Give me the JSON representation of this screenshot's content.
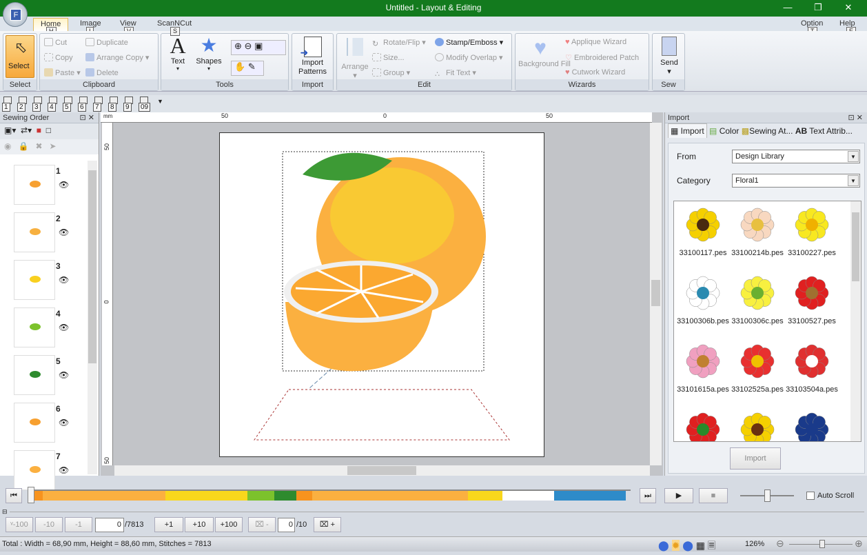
{
  "window": {
    "title": "Untitled - Layout & Editing",
    "app_letter": "F"
  },
  "menu_tabs": [
    {
      "label": "Home",
      "key": "H"
    },
    {
      "label": "Image",
      "key": "I"
    },
    {
      "label": "View",
      "key": "V"
    },
    {
      "label": "ScanNCut",
      "key": "S"
    }
  ],
  "menu_right": [
    {
      "label": "Option",
      "key": "T"
    },
    {
      "label": "Help",
      "key": "E"
    }
  ],
  "ribbon": {
    "select": {
      "label": "Select",
      "group": "Select"
    },
    "clipboard": {
      "group": "Clipboard",
      "cut": "Cut",
      "copy": "Copy",
      "paste": "Paste",
      "duplicate": "Duplicate",
      "arrange_copy": "Arrange Copy",
      "delete": "Delete"
    },
    "tools": {
      "group": "Tools",
      "text": "Text",
      "shapes": "Shapes"
    },
    "import": {
      "group": "Import",
      "import_patterns": "Import Patterns"
    },
    "edit": {
      "group": "Edit",
      "arrange": "Arrange",
      "rotate_flip": "Rotate/Flip",
      "size": "Size...",
      "group_btn": "Group",
      "stamp_emboss": "Stamp/Emboss",
      "modify_overlap": "Modify Overlap",
      "fit_text": "Fit Text"
    },
    "wizards": {
      "group": "Wizards",
      "background_fill": "Background Fill",
      "applique": "Applique Wizard",
      "patch": "Embroidered Patch",
      "cutwork": "Cutwork Wizard"
    },
    "sew": {
      "group": "Sew",
      "send": "Send"
    }
  },
  "quick_access_keys": [
    "1",
    "2",
    "3",
    "4",
    "5",
    "6",
    "7",
    "8",
    "9",
    "09"
  ],
  "sewing_order": {
    "title": "Sewing Order",
    "items": [
      {
        "num": "1",
        "color": "#f7a030"
      },
      {
        "num": "2",
        "color": "#f7b040"
      },
      {
        "num": "3",
        "color": "#f9d020"
      },
      {
        "num": "4",
        "color": "#7cc22c"
      },
      {
        "num": "5",
        "color": "#2e8b2e"
      },
      {
        "num": "6",
        "color": "#f7a030"
      },
      {
        "num": "7",
        "color": "#fbb040"
      }
    ]
  },
  "rulers": {
    "top": [
      "50",
      "0",
      "50"
    ],
    "left": [
      "50",
      "0",
      "50"
    ],
    "unit": "mm"
  },
  "import_panel": {
    "title": "Import",
    "tabs": [
      "Import",
      "Color",
      "Sewing At...",
      "Text Attrib..."
    ],
    "from_label": "From",
    "from_value": "Design Library",
    "category_label": "Category",
    "category_value": "Floral1",
    "designs": [
      {
        "name": "33100117.pes",
        "petal": "#f5d000",
        "center": "#4a2a10"
      },
      {
        "name": "33100214b.pes",
        "petal": "#f8d8c0",
        "center": "#e8c040"
      },
      {
        "name": "33100227.pes",
        "petal": "#f8e820",
        "center": "#f0b000"
      },
      {
        "name": "33100306b.pes",
        "petal": "#ffffff",
        "center": "#2a8ab0"
      },
      {
        "name": "33100306c.pes",
        "petal": "#f8f040",
        "center": "#6ab030"
      },
      {
        "name": "33100527.pes",
        "petal": "#e02020",
        "center": "#a07030"
      },
      {
        "name": "33101615a.pes",
        "petal": "#f0a0c0",
        "center": "#c08030"
      },
      {
        "name": "33102525a.pes",
        "petal": "#e83030",
        "center": "#f0c000"
      },
      {
        "name": "33103504a.pes",
        "petal": "#e03030",
        "center": "#ffffff"
      },
      {
        "name": "",
        "petal": "#e02020",
        "center": "#2a8a2a"
      },
      {
        "name": "",
        "petal": "#f5d000",
        "center": "#6a3010"
      },
      {
        "name": "",
        "petal": "#1a3a8a",
        "center": "#1a3a8a"
      }
    ],
    "import_button": "Import"
  },
  "color_bar": [
    {
      "color": "#f7931e",
      "pct": 1.9
    },
    {
      "color": "#fbb040",
      "pct": 20.5
    },
    {
      "color": "#f9d71c",
      "pct": 13.7
    },
    {
      "color": "#7cc22c",
      "pct": 4.5
    },
    {
      "color": "#2e8b2e",
      "pct": 3.7
    },
    {
      "color": "#f7931e",
      "pct": 2.6
    },
    {
      "color": "#fbb040",
      "pct": 26
    },
    {
      "color": "#f9d71c",
      "pct": 5.7
    },
    {
      "color": "#ffffff",
      "pct": 8.6
    },
    {
      "color": "#2e8bc9",
      "pct": 12
    }
  ],
  "stitch_controls": {
    "minus100": "-100",
    "minus10": "-10",
    "minus1": "-1",
    "current": "0",
    "total": "/7813",
    "plus1": "+1",
    "plus10": "+10",
    "plus100": "+100",
    "color_current": "0",
    "color_total": "/10",
    "auto_scroll": "Auto Scroll",
    "speed": 0.5
  },
  "status": {
    "text": "Total : Width = 68,90 mm, Height = 88,60 mm, Stitches = 7813",
    "zoom": "126%"
  }
}
